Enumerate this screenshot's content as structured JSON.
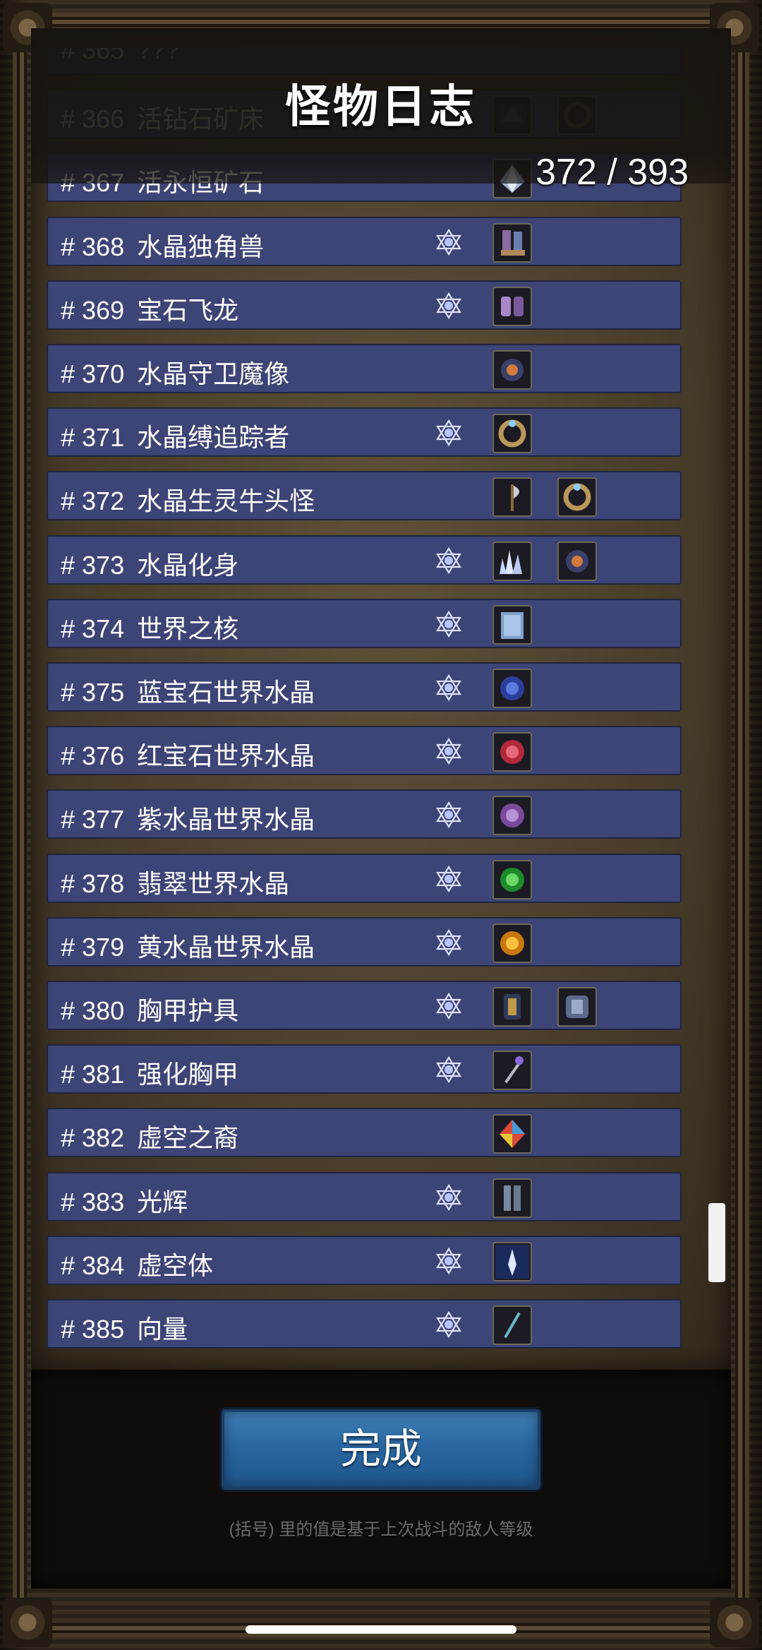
{
  "header": {
    "title": "怪物日志",
    "count": "372 / 393"
  },
  "rows": [
    {
      "num": "# 365",
      "name": "???",
      "gem": false,
      "items": []
    },
    {
      "num": "# 366",
      "name": "活钻石矿床",
      "gem": false,
      "items": [
        "dark-ore-icon",
        "dark-ring-icon"
      ]
    },
    {
      "num": "# 367",
      "name": "活永恒矿石",
      "gem": false,
      "items": [
        "crystal-ore-icon"
      ]
    },
    {
      "num": "# 368",
      "name": "水晶独角兽",
      "gem": true,
      "items": [
        "boots-icon"
      ]
    },
    {
      "num": "# 369",
      "name": "宝石飞龙",
      "gem": true,
      "items": [
        "gloves-icon"
      ]
    },
    {
      "num": "# 370",
      "name": "水晶守卫魔像",
      "gem": false,
      "items": [
        "amulet-icon"
      ]
    },
    {
      "num": "# 371",
      "name": "水晶缚追踪者",
      "gem": true,
      "items": [
        "ring-icon"
      ]
    },
    {
      "num": "# 372",
      "name": "水晶生灵牛头怪",
      "gem": false,
      "items": [
        "axe-icon",
        "ring-icon"
      ]
    },
    {
      "num": "# 373",
      "name": "水晶化身",
      "gem": true,
      "items": [
        "crystal-cluster-icon",
        "amulet-icon"
      ]
    },
    {
      "num": "# 374",
      "name": "世界之核",
      "gem": true,
      "items": [
        "tome-icon"
      ]
    },
    {
      "num": "# 375",
      "name": "蓝宝石世界水晶",
      "gem": true,
      "items": [
        "sapphire-icon"
      ]
    },
    {
      "num": "# 376",
      "name": "红宝石世界水晶",
      "gem": true,
      "items": [
        "ruby-icon"
      ]
    },
    {
      "num": "# 377",
      "name": "紫水晶世界水晶",
      "gem": true,
      "items": [
        "amethyst-icon"
      ]
    },
    {
      "num": "# 378",
      "name": "翡翠世界水晶",
      "gem": true,
      "items": [
        "emerald-icon"
      ]
    },
    {
      "num": "# 379",
      "name": "黄水晶世界水晶",
      "gem": true,
      "items": [
        "topaz-icon"
      ]
    },
    {
      "num": "# 380",
      "name": "胸甲护具",
      "gem": true,
      "items": [
        "armor-icon",
        "chest-armor-icon"
      ]
    },
    {
      "num": "# 381",
      "name": "强化胸甲",
      "gem": true,
      "items": [
        "scepter-icon"
      ]
    },
    {
      "num": "# 382",
      "name": "虚空之裔",
      "gem": false,
      "items": [
        "prism-icon"
      ]
    },
    {
      "num": "# 383",
      "name": "光辉",
      "gem": true,
      "items": [
        "leggings-icon"
      ]
    },
    {
      "num": "# 384",
      "name": "虚空体",
      "gem": true,
      "items": [
        "glow-crystal-icon"
      ]
    },
    {
      "num": "# 385",
      "name": "向量",
      "gem": true,
      "items": [
        "sword-icon"
      ]
    }
  ],
  "footer": {
    "done_label": "完成",
    "hint": "(括号) 里的值是基于上次战斗的敌人等级"
  }
}
